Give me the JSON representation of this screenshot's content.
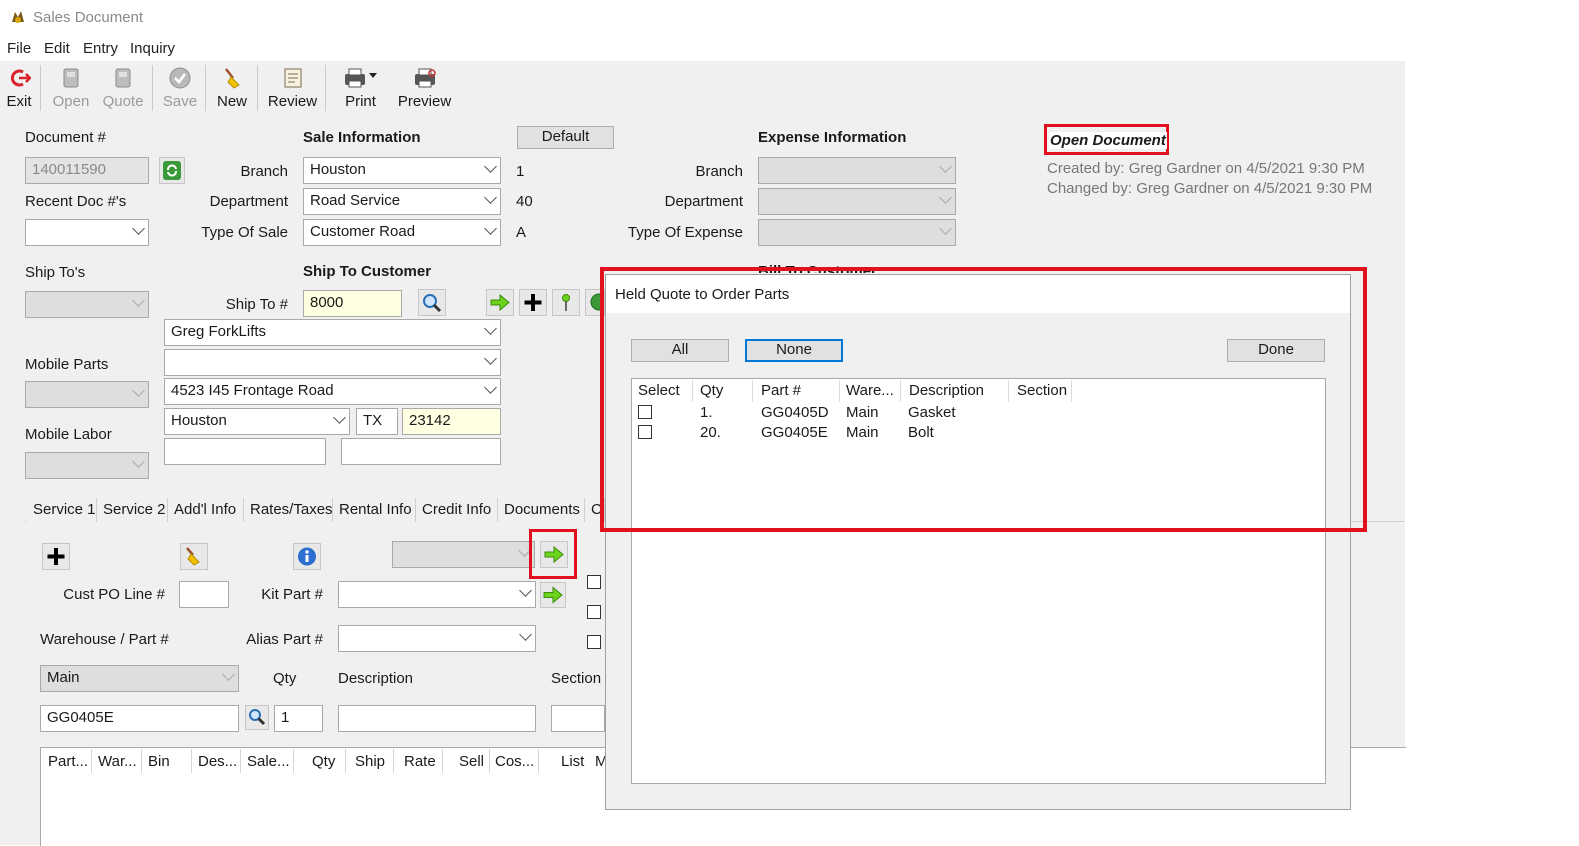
{
  "window": {
    "title": "Sales Document"
  },
  "menu": [
    "File",
    "Edit",
    "Entry",
    "Inquiry"
  ],
  "toolbar": {
    "exit": "Exit",
    "open": "Open",
    "quote": "Quote",
    "save": "Save",
    "new": "New",
    "review": "Review",
    "print": "Print",
    "preview": "Preview"
  },
  "document": {
    "label": "Document #",
    "number": "140011590",
    "recent_label": "Recent Doc #'s",
    "ship_tos_label": "Ship To's",
    "mobile_parts_label": "Mobile Parts",
    "mobile_labor_label": "Mobile Labor"
  },
  "sale_info": {
    "heading": "Sale Information",
    "default_button": "Default",
    "branch_label": "Branch",
    "branch": "Houston",
    "branch_code": "1",
    "department_label": "Department",
    "department": "Road Service",
    "department_code": "40",
    "type_label": "Type Of Sale",
    "type": "Customer Road",
    "type_code": "A"
  },
  "expense_info": {
    "heading": "Expense Information",
    "branch_label": "Branch",
    "department_label": "Department",
    "type_label": "Type Of Expense"
  },
  "status": {
    "badge": "Open Document",
    "created": "Created by: Greg Gardner on 4/5/2021 9:30 PM",
    "changed": "Changed by: Greg Gardner on 4/5/2021 9:30 PM"
  },
  "ship_to": {
    "heading": "Ship To Customer",
    "number_label": "Ship To #",
    "number": "8000",
    "name": "Greg ForkLifts",
    "address2": "",
    "address": "4523 I45 Frontage Road",
    "city": "Houston",
    "state": "TX",
    "zip": "23142",
    "bill_to_partial": "Bill To Customer"
  },
  "tabs": [
    "Service 1",
    "Service 2",
    "Add'l Info",
    "Rates/Taxes",
    "Rental Info",
    "Credit Info",
    "Documents",
    "C"
  ],
  "lines": {
    "cust_po_label": "Cust PO Line #",
    "kit_part_label": "Kit Part #",
    "warehouse_label": "Warehouse / Part #",
    "alias_label": "Alias Part #",
    "warehouse": "Main",
    "qty_label": "Qty",
    "description_label": "Description",
    "section_label": "Section",
    "part": "GG0405E",
    "qty": "1",
    "grid_headers": [
      "Part...",
      "War...",
      "Bin",
      "Des...",
      "Sale...",
      "Qty",
      "Ship",
      "Rate",
      "Sell",
      "Cos...",
      "List",
      "M"
    ]
  },
  "dialog": {
    "title": "Held Quote to Order Parts",
    "all_button": "All",
    "none_button": "None",
    "done_button": "Done",
    "headers": [
      "Select",
      "Qty",
      "Part #",
      "Ware...",
      "Description",
      "Section"
    ],
    "rows": [
      {
        "qty": "1.",
        "part": "GG0405D",
        "warehouse": "Main",
        "description": "Gasket",
        "section": ""
      },
      {
        "qty": "20.",
        "part": "GG0405E",
        "warehouse": "Main",
        "description": "Bolt",
        "section": ""
      }
    ]
  },
  "colors": {
    "highlight_red": "#e3101f",
    "focus_blue": "#0078d7",
    "input_yellow": "#ffffe1"
  }
}
